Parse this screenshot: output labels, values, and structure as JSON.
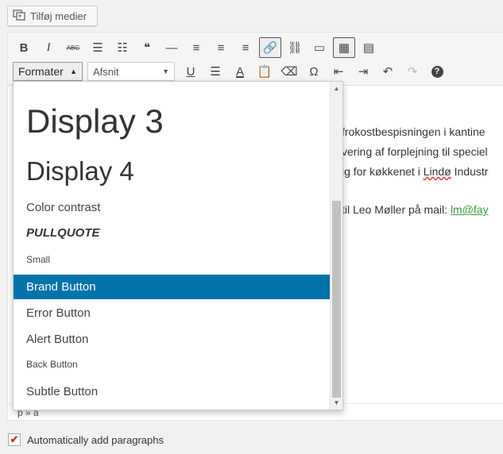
{
  "add_media": {
    "label": "Tilføj medier",
    "icon": "media-icon"
  },
  "toolbar": {
    "row1": [
      {
        "name": "bold",
        "glyph": "B"
      },
      {
        "name": "italic",
        "glyph": "I"
      },
      {
        "name": "strikethrough",
        "glyph": "ABC"
      },
      {
        "name": "bullet-list",
        "glyph": "☰"
      },
      {
        "name": "numbered-list",
        "glyph": "☷"
      },
      {
        "name": "blockquote",
        "glyph": "❝"
      },
      {
        "name": "horizontal-line",
        "glyph": "—"
      },
      {
        "name": "align-left",
        "glyph": "≡"
      },
      {
        "name": "align-center",
        "glyph": "≡"
      },
      {
        "name": "align-right",
        "glyph": "≡"
      },
      {
        "name": "insert-link",
        "glyph": "🔗"
      },
      {
        "name": "remove-link",
        "glyph": "⛓"
      },
      {
        "name": "read-more",
        "glyph": "▭"
      },
      {
        "name": "toolbar-toggle",
        "glyph": "▦"
      },
      {
        "name": "shortcode",
        "glyph": "▤"
      }
    ],
    "formatter_label": "Formater",
    "paragraph_select": "Afsnit",
    "row2": [
      {
        "name": "underline",
        "glyph": "U"
      },
      {
        "name": "justify",
        "glyph": "☰"
      },
      {
        "name": "text-color",
        "glyph": "A"
      },
      {
        "name": "paste-as-text",
        "glyph": "📋"
      },
      {
        "name": "clear-formatting",
        "glyph": "⌫"
      },
      {
        "name": "special-character",
        "glyph": "Ω"
      },
      {
        "name": "outdent",
        "glyph": "⇤"
      },
      {
        "name": "indent",
        "glyph": "⇥"
      },
      {
        "name": "undo",
        "glyph": "↶"
      },
      {
        "name": "redo",
        "glyph": "↷"
      },
      {
        "name": "help",
        "glyph": "?"
      }
    ]
  },
  "content": {
    "line1": "frokostbespisningen i kantine",
    "line2": "vering af forplejning til speciel",
    "line3_pre": "ig for køkkenet i ",
    "line3_link": "Lindø",
    "line3_post": " Industr",
    "line4_pre": " til Leo Møller på mail: ",
    "line4_link": "lm@fay"
  },
  "dropdown": {
    "items": [
      {
        "label": "Display 3",
        "style": "display3"
      },
      {
        "label": "Display 4",
        "style": "display4"
      },
      {
        "label": "Color contrast",
        "style": "normal"
      },
      {
        "label": "PULLQUOTE",
        "style": "pullquote"
      },
      {
        "label": "Small",
        "style": "small"
      },
      {
        "label": "Brand Button",
        "style": "selected"
      },
      {
        "label": "Error Button",
        "style": "button"
      },
      {
        "label": "Alert Button",
        "style": "button"
      },
      {
        "label": "Back Button",
        "style": "small"
      },
      {
        "label": "Subtle Button",
        "style": "button"
      }
    ]
  },
  "statusbar": {
    "path": "p » a"
  },
  "footer": {
    "auto_paragraphs_label": "Automatically add paragraphs",
    "checked": true
  },
  "colors": {
    "accent": "#0073aa",
    "link": "#3a9a3a"
  }
}
